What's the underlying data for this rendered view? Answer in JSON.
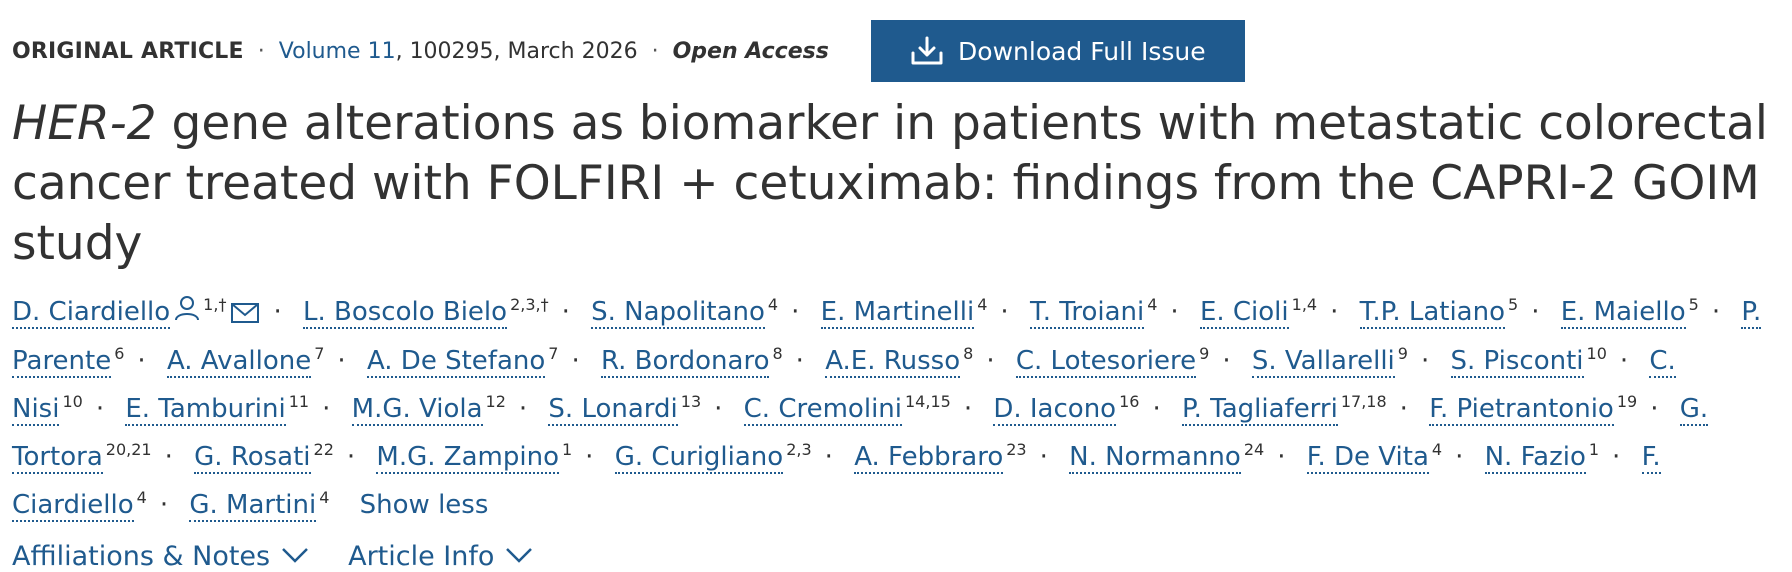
{
  "header": {
    "article_type": "ORIGINAL ARTICLE",
    "volume_link": "Volume 11",
    "volume_rest": ", 100295, March 2026",
    "open_access": "Open Access",
    "download_label": "Download Full Issue"
  },
  "title": {
    "gene": "HER-2",
    "rest": " gene alterations as biomarker in patients with metastatic colorectal cancer treated with FOLFIRI + cetuximab: findings from the CAPRI-2 GOIM study"
  },
  "authors": [
    {
      "name": "D. Ciardiello",
      "aff": "1,†",
      "icons": true
    },
    {
      "name": "L. Boscolo Bielo",
      "aff": "2,3,†"
    },
    {
      "name": "S. Napolitano",
      "aff": "4"
    },
    {
      "name": "E. Martinelli",
      "aff": "4"
    },
    {
      "name": "T. Troiani",
      "aff": "4"
    },
    {
      "name": "E. Cioli",
      "aff": "1,4"
    },
    {
      "name": "T.P. Latiano",
      "aff": "5"
    },
    {
      "name": "E. Maiello",
      "aff": "5"
    },
    {
      "name": "P. Parente",
      "aff": "6"
    },
    {
      "name": "A. Avallone",
      "aff": "7"
    },
    {
      "name": "A. De Stefano",
      "aff": "7"
    },
    {
      "name": "R. Bordonaro",
      "aff": "8"
    },
    {
      "name": "A.E. Russo",
      "aff": "8"
    },
    {
      "name": "C. Lotesoriere",
      "aff": "9"
    },
    {
      "name": "S. Vallarelli",
      "aff": "9"
    },
    {
      "name": "S. Pisconti",
      "aff": "10"
    },
    {
      "name": "C. Nisi",
      "aff": "10"
    },
    {
      "name": "E. Tamburini",
      "aff": "11"
    },
    {
      "name": "M.G. Viola",
      "aff": "12"
    },
    {
      "name": "S. Lonardi",
      "aff": "13"
    },
    {
      "name": "C. Cremolini",
      "aff": "14,15"
    },
    {
      "name": "D. Iacono",
      "aff": "16"
    },
    {
      "name": "P. Tagliaferri",
      "aff": "17,18"
    },
    {
      "name": "F. Pietrantonio",
      "aff": "19"
    },
    {
      "name": "G. Tortora",
      "aff": "20,21"
    },
    {
      "name": "G. Rosati",
      "aff": "22"
    },
    {
      "name": "M.G. Zampino",
      "aff": "1"
    },
    {
      "name": "G. Curigliano",
      "aff": "2,3"
    },
    {
      "name": "A. Febbraro",
      "aff": "23"
    },
    {
      "name": "N. Normanno",
      "aff": "24"
    },
    {
      "name": "F. De Vita",
      "aff": "4"
    },
    {
      "name": "N. Fazio",
      "aff": "1"
    },
    {
      "name": "F. Ciardiello",
      "aff": "4"
    },
    {
      "name": "G. Martini",
      "aff": "4"
    }
  ],
  "show_less_label": "Show less",
  "links": {
    "affiliations": "Affiliations & Notes",
    "article_info": "Article Info"
  },
  "separator": "·",
  "colors": {
    "link": "#1f5a8e",
    "button_bg": "#1f5a8e",
    "text": "#323232"
  },
  "icons": [
    "download-icon",
    "person-icon",
    "envelope-icon",
    "chevron-down-icon"
  ]
}
